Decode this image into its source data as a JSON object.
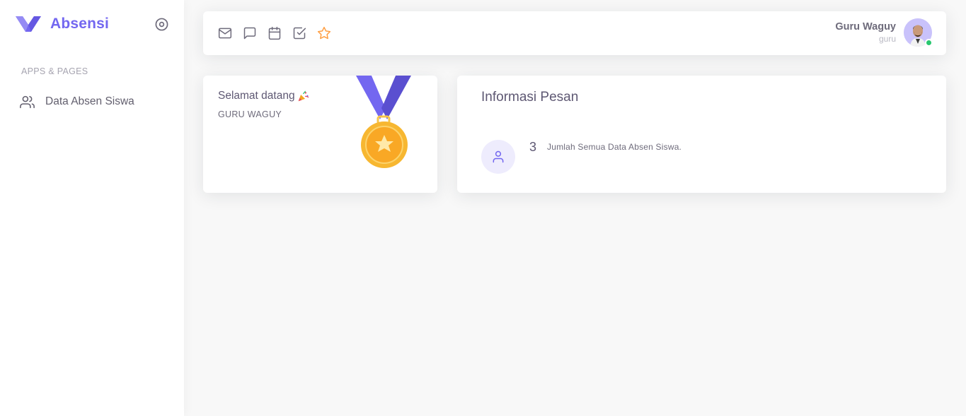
{
  "sidebar": {
    "brand": "Absensi",
    "section_header": "APPS & PAGES",
    "items": [
      {
        "label": "Data Absen Siswa",
        "icon": "users-icon"
      }
    ]
  },
  "topbar": {
    "bookmarks": [
      "mail-icon",
      "chat-icon",
      "calendar-icon",
      "check-square-icon",
      "star-icon"
    ],
    "user": {
      "name": "Guru Waguy",
      "role": "guru",
      "status": "online"
    }
  },
  "welcome_card": {
    "title": "Selamat datang",
    "subtitle": "GURU WAGUY"
  },
  "info_card": {
    "title": "Informasi Pesan",
    "stat": {
      "value": "3",
      "label": "Jumlah Semua Data Absen Siswa."
    }
  },
  "colors": {
    "primary": "#7367f0",
    "warning": "#ff9f43",
    "success": "#28c76f",
    "body_bg": "#f8f8f8"
  }
}
